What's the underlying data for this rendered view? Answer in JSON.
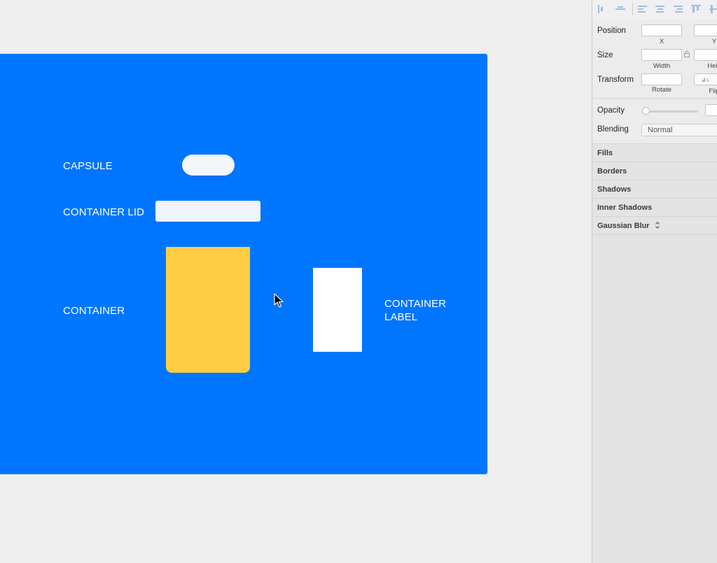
{
  "artboard": {
    "labels": {
      "capsule": "CAPSULE",
      "container_lid": "CONTAINER LID",
      "container": "CONTAINER",
      "container_label_line1": "CONTAINER",
      "container_label_line2": "LABEL"
    },
    "colors": {
      "background": "#0076ff",
      "container": "#ffcc44",
      "capsule": "#f3f6fb",
      "label_box": "#ffffff"
    }
  },
  "inspector": {
    "toolbar_icons": [
      "align-left-edge-icon",
      "align-horizontal-center-icon",
      "distribute-left-icon",
      "distribute-center-icon",
      "distribute-right-icon",
      "align-top-icon",
      "align-middle-icon"
    ],
    "position_label": "Position",
    "x_label": "X",
    "y_label": "Y",
    "size_label": "Size",
    "width_label": "Width",
    "height_label": "Heig",
    "transform_label": "Transform",
    "rotate_label": "Rotate",
    "flip_label": "Flip",
    "opacity_label": "Opacity",
    "blending_label": "Blending",
    "blending_value": "Normal",
    "sections": [
      "Fills",
      "Borders",
      "Shadows",
      "Inner Shadows",
      "Gaussian Blur"
    ]
  }
}
